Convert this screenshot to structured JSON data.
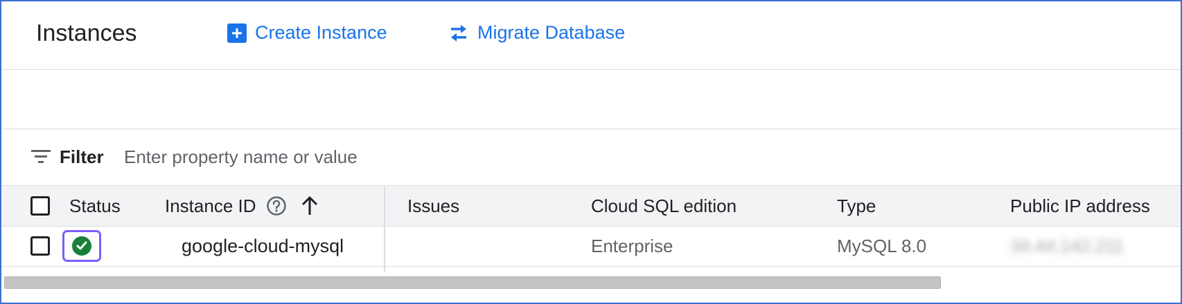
{
  "header": {
    "title": "Instances",
    "actions": [
      {
        "label": "Create Instance",
        "icon": "add-box-icon"
      },
      {
        "label": "Migrate Database",
        "icon": "swap-arrows-icon"
      }
    ]
  },
  "filter": {
    "label": "Filter",
    "placeholder": "Enter property name or value",
    "icon": "filter-list-icon"
  },
  "table": {
    "columns": [
      {
        "label": "Status"
      },
      {
        "label": "Instance ID",
        "help_icon": "help-circle-icon",
        "sort_icon": "arrow-up-icon"
      },
      {
        "label": "Issues"
      },
      {
        "label": "Cloud SQL edition"
      },
      {
        "label": "Type"
      },
      {
        "label": "Public IP address"
      }
    ],
    "rows": [
      {
        "status": "ok",
        "instance_id": "google-cloud-mysql",
        "issues": "",
        "edition": "Enterprise",
        "type": "MySQL 8.0",
        "public_ip": "34.44.142.211"
      }
    ]
  },
  "colors": {
    "accent": "#1a73e8",
    "status_ok": "#188038",
    "focus_ring": "#7c5cff",
    "frame_border": "#3c6fd1"
  }
}
